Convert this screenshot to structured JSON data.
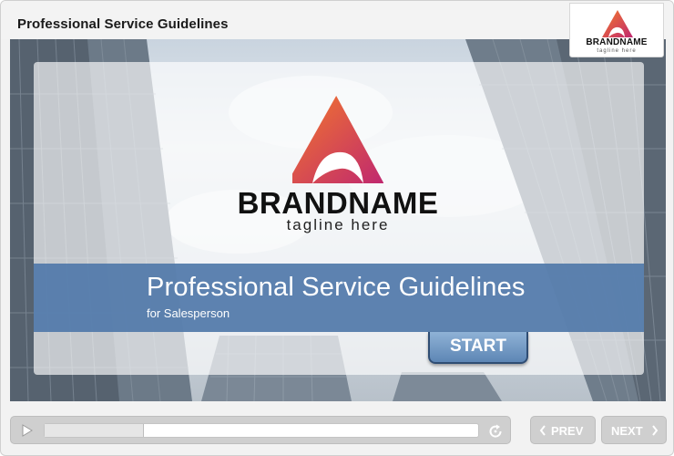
{
  "header": {
    "title": "Professional Service Guidelines",
    "corner_logo": {
      "name": "BRANDNAME",
      "tagline": "tagline here"
    }
  },
  "slide": {
    "logo": {
      "name": "BRANDNAME",
      "tagline": "tagline here",
      "icon": "brand-triangle-icon"
    },
    "title": "Professional Service Guidelines",
    "subtitle": "for Salesperson",
    "start_label": "START"
  },
  "player": {
    "progress": 0.23,
    "play_icon": "play-icon",
    "replay_icon": "replay-icon",
    "prev_label": "PREV",
    "next_label": "NEXT"
  },
  "colors": {
    "banner": "#527aaa",
    "brand_gradient_start": "#f47a2a",
    "brand_gradient_end": "#c0286f",
    "button_gray": "#cfcfcf"
  }
}
